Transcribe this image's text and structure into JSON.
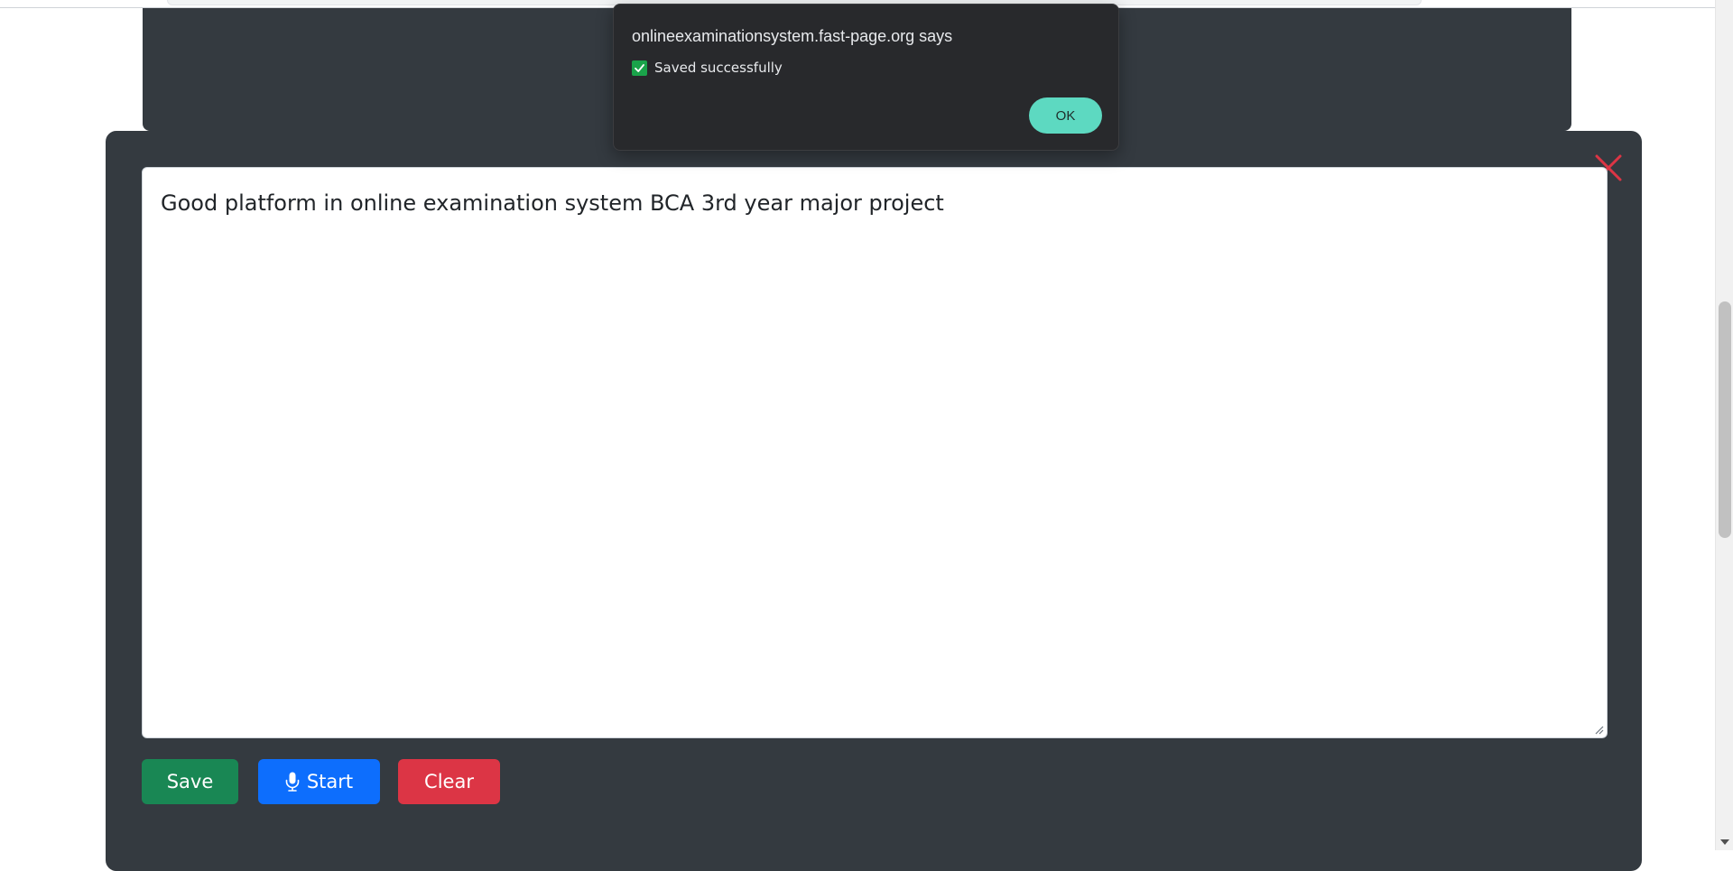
{
  "alert": {
    "origin": "onlineexaminationsystem.fast-page.org says",
    "message": "Saved successfully",
    "ok_label": "OK"
  },
  "note": {
    "text": "Good platform in online examination system BCA 3rd year major project"
  },
  "buttons": {
    "save_label": "Save",
    "start_label": "Start",
    "clear_label": "Clear"
  },
  "icons": {
    "close": "close-icon",
    "mic": "microphone-icon",
    "check": "checkmark-icon"
  },
  "colors": {
    "panel": "#343a40",
    "save": "#198754",
    "start": "#0d6efd",
    "clear": "#dc3545",
    "close": "#dc3545",
    "alert_bg": "#28292c",
    "alert_ok": "#5dd9c1",
    "check": "#1aa34a"
  }
}
